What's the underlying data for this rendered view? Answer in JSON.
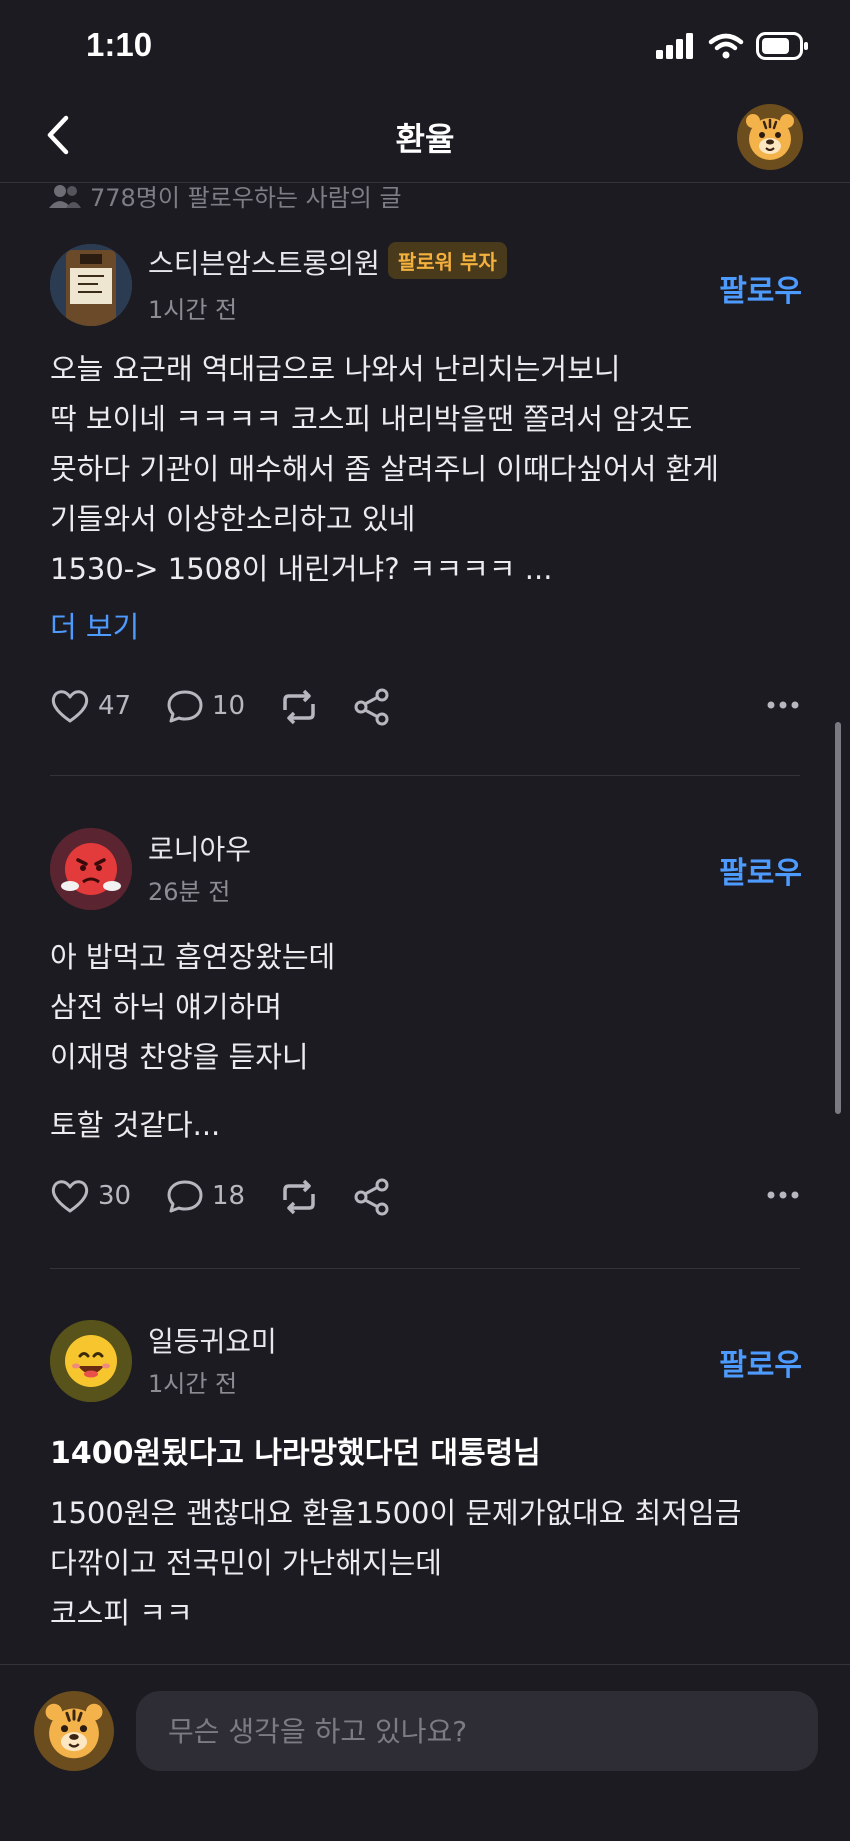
{
  "status_bar": {
    "time": "1:10"
  },
  "header": {
    "title": "환율"
  },
  "followers_note": "778명이 팔로우하는 사람의 글",
  "posts": [
    {
      "author": "스티븐암스트롱의원",
      "badge": "팔로워 부자",
      "time": "1시간 전",
      "follow_label": "팔로우",
      "lines": [
        "오늘 요근래 역대급으로 나와서 난리치는거보니",
        "딱 보이네 ㅋㅋㅋㅋ 코스피 내리박을땐 쫄려서 암것도",
        "못하다 기관이 매수해서 좀 살려주니 이때다싶어서 환게",
        "기들와서 이상한소리하고 있네",
        "1530-> 1508이 내린거냐? ㅋㅋㅋㅋ ..."
      ],
      "more_label": "더 보기",
      "likes": "47",
      "comments": "10"
    },
    {
      "author": "로니아우",
      "time": "26분 전",
      "follow_label": "팔로우",
      "lines": [
        "아 밥먹고 흡연장왔는데",
        "삼전 하닉 얘기하며",
        "이재명 찬양을 듣자니"
      ],
      "extra_line": "토할 것같다...",
      "likes": "30",
      "comments": "18"
    },
    {
      "author": "일등귀요미",
      "time": "1시간 전",
      "follow_label": "팔로우",
      "title": "1400원됬다고 나라망했다던 대통령님",
      "lines": [
        "1500원은 괜찮대요 환율1500이 문제가없대요 최저임금",
        "다깎이고 전국민이 가난해지는데",
        "코스피 ㅋㅋ"
      ]
    }
  ],
  "composer": {
    "placeholder": "무슨 생각을 하고 있나요?"
  },
  "colors": {
    "background": "#1c1b22",
    "accent": "#4e9bff",
    "badge_text": "#f5b13d"
  }
}
